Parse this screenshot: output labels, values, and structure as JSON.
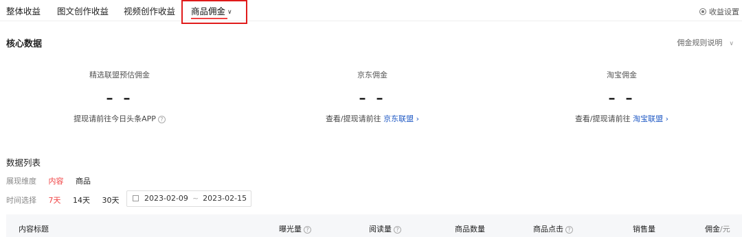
{
  "tabs": {
    "overall": "整体收益",
    "article": "图文创作收益",
    "video": "视频创作收益",
    "commission": "商品佣金",
    "settings": "收益设置"
  },
  "core": {
    "title": "核心数据",
    "rules_link": "佣金规则说明",
    "metrics": [
      {
        "label": "精选联盟预估佣金",
        "value": "– –",
        "note_prefix": "提现请前往今日头条APP",
        "link": ""
      },
      {
        "label": "京东佣金",
        "value": "– –",
        "note_prefix": "查看/提现请前往",
        "link": "京东联盟"
      },
      {
        "label": "淘宝佣金",
        "value": "– –",
        "note_prefix": "查看/提现请前往",
        "link": "淘宝联盟"
      }
    ]
  },
  "list": {
    "title": "数据列表",
    "dimension_label": "展现维度",
    "dimension_options": [
      "内容",
      "商品"
    ],
    "time_label": "时间选择",
    "time_options": [
      "7天",
      "14天",
      "30天"
    ],
    "date_start": "2023-02-09",
    "date_sep": "~",
    "date_end": "2023-02-15"
  },
  "table": {
    "headers": [
      "内容标题",
      "曝光量",
      "阅读量",
      "商品数量",
      "商品点击",
      "销售量",
      "佣金"
    ],
    "commission_unit": "/元"
  },
  "colors": {
    "accent": "#f04142",
    "link": "#1f59c4",
    "highlight_box": "#e01a1a"
  }
}
